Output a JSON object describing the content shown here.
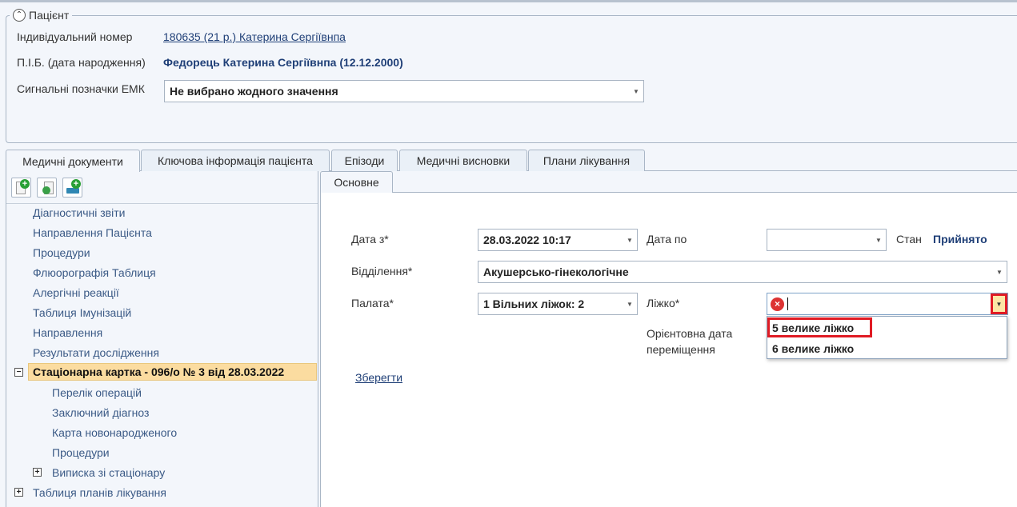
{
  "patient": {
    "legend": "Пацієнт",
    "id_label": "Індивідуальний номер",
    "id_value": "180635 (21 р.) Катерина Сергіївнпа",
    "name_label": "П.І.Б. (дата народження)",
    "name_value": "Федорець Катерина Сергіївнпа (12.12.2000)",
    "signals_label": "Сигнальні позначки ЕМК",
    "signals_value": "Не вибрано жодного значення"
  },
  "main_tabs": [
    {
      "label": "Медичні документи",
      "active": true
    },
    {
      "label": "Ключова інформація пацієнта"
    },
    {
      "label": "Епізоди"
    },
    {
      "label": "Медичні висновки"
    },
    {
      "label": "Плани лікування"
    }
  ],
  "tree": {
    "items": [
      "Діагностичні звіти",
      "Направлення Пацієнта",
      "Процедури",
      "Флюорографія Таблиця",
      "Алергічні реакції",
      "Таблиця Імунізацій",
      "Направлення",
      "Результати дослідження"
    ],
    "selected": "Стаціонарна картка - 096/о № 3 від 28.03.2022",
    "children": [
      "Перелік операцій",
      "Заключний діагноз",
      "Карта новонародженого",
      "Процедури",
      "Виписка зі стаціонару"
    ],
    "last": "Таблиця планів лікування",
    "toggle_minus": "−",
    "toggle_plus": "+"
  },
  "form": {
    "tab": "Основне",
    "date_from_label": "Дата з*",
    "date_from_value": "28.03.2022 10:17",
    "date_to_label": "Дата по",
    "date_to_value": "",
    "status_label": "Стан",
    "status_value": "Прийнято",
    "department_label": "Відділення*",
    "department_value": "Акушерсько-гінекологічне",
    "ward_label": "Палата*",
    "ward_value": "1 Вільних ліжок: 2",
    "bed_label": "Ліжко*",
    "bed_value": "",
    "bed_options": [
      "5 велике ліжко",
      "6 велике ліжко"
    ],
    "move_date_label_1": "Орієнтовна дата",
    "move_date_label_2": "переміщення",
    "save_label": "Зберегти"
  },
  "icons": {
    "arrow": "▼",
    "collapse": "⌃",
    "error": "×",
    "plus": "+"
  },
  "colors": {
    "selected_bg": "#fbdca0",
    "link": "#1f3f77",
    "error": "#d33333",
    "highlight_border": "#e01b24"
  }
}
